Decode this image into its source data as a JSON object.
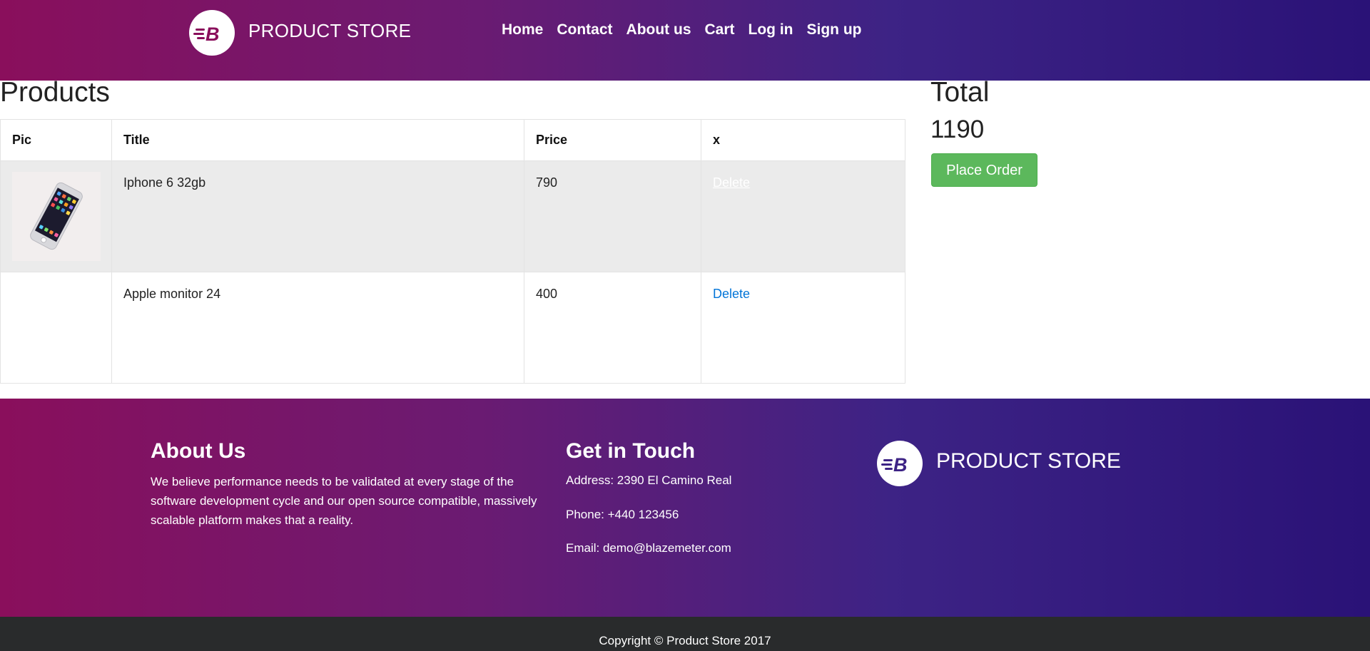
{
  "header": {
    "brand": "PRODUCT STORE",
    "nav": [
      "Home",
      "Contact",
      "About us",
      "Cart",
      "Log in",
      "Sign up"
    ]
  },
  "cart": {
    "heading": "Products",
    "columns": [
      "Pic",
      "Title",
      "Price",
      "x"
    ],
    "rows": [
      {
        "title": "Iphone 6 32gb",
        "price": "790",
        "action": "Delete",
        "has_image": true
      },
      {
        "title": "Apple monitor 24",
        "price": "400",
        "action": "Delete",
        "has_image": false
      }
    ]
  },
  "summary": {
    "label": "Total",
    "value": "1190",
    "place_order": "Place Order"
  },
  "footer": {
    "about_title": "About Us",
    "about_text": "We believe performance needs to be validated at every stage of the software development cycle and our open source compatible, massively scalable platform makes that a reality.",
    "touch_title": "Get in Touch",
    "address": "Address: 2390 El Camino Real",
    "phone": "Phone: +440 123456",
    "email": "Email: demo@blazemeter.com",
    "brand": "PRODUCT STORE",
    "copyright": "Copyright © Product Store 2017"
  },
  "colors": {
    "gradient_start": "#8a0f5c",
    "gradient_end": "#2a1277",
    "place_order_bg": "#5cb85c",
    "link": "#0275d8",
    "copyright_bg": "#292b2c"
  },
  "icons": {
    "logo": "blazemeter-logo-icon"
  }
}
